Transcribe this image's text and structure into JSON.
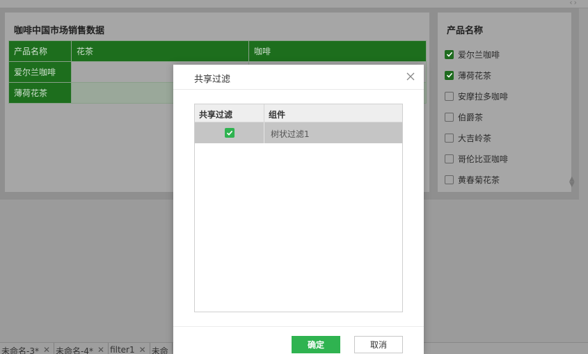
{
  "colors": {
    "accent_green": "#2fb350",
    "header_green": "#1d6e1d"
  },
  "report": {
    "title": "咖啡中国市场销售数据",
    "table": {
      "corner": "产品名称",
      "columns": [
        "花茶",
        "咖啡"
      ],
      "rows": [
        "爱尔兰咖啡",
        "薄荷花茶"
      ]
    }
  },
  "filter_panel": {
    "title": "产品名称",
    "options": [
      {
        "label": "爱尔兰咖啡",
        "checked": true
      },
      {
        "label": "薄荷花茶",
        "checked": true
      },
      {
        "label": "安摩拉多咖啡",
        "checked": false
      },
      {
        "label": "伯爵茶",
        "checked": false
      },
      {
        "label": "大吉岭茶",
        "checked": false
      },
      {
        "label": "哥伦比亚咖啡",
        "checked": false
      },
      {
        "label": "黄春菊花茶",
        "checked": false
      }
    ]
  },
  "tabs": [
    {
      "label": "未命名-3*"
    },
    {
      "label": "未命名-4*"
    },
    {
      "label": "filter1"
    },
    {
      "label": "未命"
    }
  ],
  "dialog": {
    "title": "共享过滤",
    "table": {
      "headers": [
        "共享过滤",
        "组件"
      ],
      "rows": [
        {
          "checked": true,
          "component": "树状过滤1"
        }
      ]
    },
    "ok_label": "确定",
    "cancel_label": "取消"
  },
  "icons": {
    "close": "close-icon",
    "check": "checkmark-icon",
    "scroll": "scroll-arrows-icon"
  }
}
